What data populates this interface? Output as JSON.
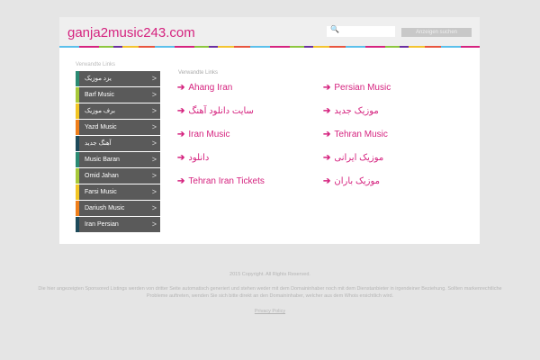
{
  "header": {
    "logo": "ganja2music243.com",
    "search_placeholder": "",
    "search_button": "Anzeigen suchen"
  },
  "sidebar": {
    "heading": "Verwandte Links",
    "items": [
      {
        "label": "یزد موزیک",
        "color": "#2a8a73"
      },
      {
        "label": "Barf Music",
        "color": "#a8c93a"
      },
      {
        "label": "برف موزیک",
        "color": "#f2c524"
      },
      {
        "label": "Yazd Music",
        "color": "#ef7f1a"
      },
      {
        "label": "آهنگ جدید",
        "color": "#1d4a5a"
      },
      {
        "label": "Music Baran",
        "color": "#2a8a73"
      },
      {
        "label": "Omid Jahan",
        "color": "#a8c93a"
      },
      {
        "label": "Farsi Music",
        "color": "#f2c524"
      },
      {
        "label": "Dariush Music",
        "color": "#ef7f1a"
      },
      {
        "label": "Iran Persian",
        "color": "#1d4a5a"
      }
    ]
  },
  "links": {
    "heading": "Verwandte Links",
    "arrow": "➔",
    "col1": [
      "Ahang Iran",
      "سایت دانلود آهنگ",
      "Iran Music",
      "دانلود",
      "Tehran Iran Tickets"
    ],
    "col2": [
      "Persian Music",
      "موزیک جدید",
      "Tehran Music",
      "موزیک ایرانی",
      "موزیک باران"
    ]
  },
  "footer": {
    "copyright": "2015 Copyright. All Rights Reserved.",
    "disclaimer": "Die hier angezeigten Sponsored Listings werden von dritter Seite automatisch generiert und stehen weder mit dem Domaininhaber noch mit dem Dienstanbieter in irgendeiner Beziehung. Sollten markenrechtliche Probleme auftreten, wenden Sie sich bitte direkt an den Domaininhaber, welcher aus dem Whois ersichtlich wird.",
    "privacy": "Privacy Policy"
  }
}
